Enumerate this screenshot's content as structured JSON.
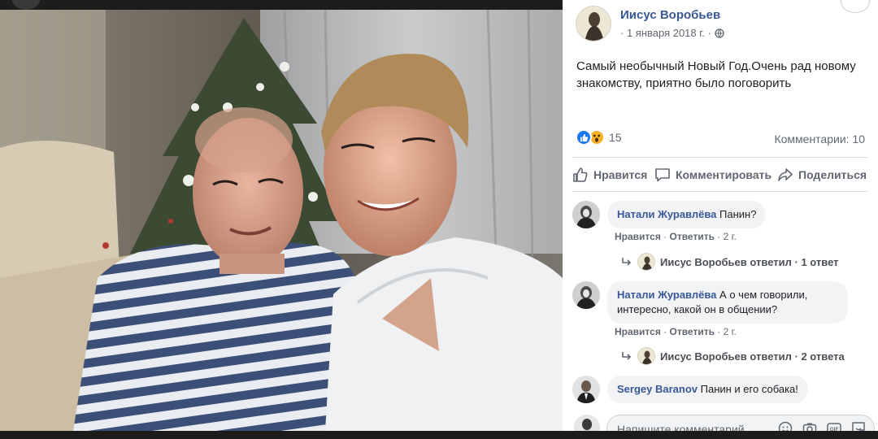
{
  "post": {
    "author": "Иисус Воробьев",
    "date": "· 1 января 2018 г. ·",
    "text": "Самый необычный Новый Год.Очень рад новому знакомству, приятно было поговорить",
    "reaction_count": "15",
    "comments_summary": "Комментарии: 10",
    "reaction_icons": [
      "like-icon",
      "wow-icon"
    ],
    "privacy_icon": "globe-icon"
  },
  "actions": {
    "like": "Нравится",
    "comment": "Комментировать",
    "share": "Поделиться"
  },
  "comments": [
    {
      "author": "Натали Журавлёва",
      "text": "Панин?",
      "like": "Нравится",
      "reply": "Ответить",
      "time": "2 г.",
      "replies": {
        "author": "Иисус Воробьев",
        "verb": "ответил",
        "count": "1 ответ"
      }
    },
    {
      "author": "Натали Журавлёва",
      "text_line1": "А о чем говорили,",
      "text_line2": "интересно, какой он в общении?",
      "like": "Нравится",
      "reply": "Ответить",
      "time": "2 г.",
      "replies": {
        "author": "Иисус Воробьев",
        "verb": "ответил",
        "count": "2 ответа"
      }
    },
    {
      "author": "Sergey Baranov",
      "text": "Панин и его собака!"
    }
  ],
  "composer": {
    "placeholder": "Напишите комментарий...",
    "icons": [
      "emoji-icon",
      "camera-icon",
      "gif-icon",
      "sticker-icon"
    ]
  },
  "colors": {
    "link_blue": "#385898",
    "like_blue": "#1877f2",
    "wow_yellow": "#f7b125",
    "bubble_gray": "#f2f3f5",
    "meta_gray": "#606770"
  }
}
